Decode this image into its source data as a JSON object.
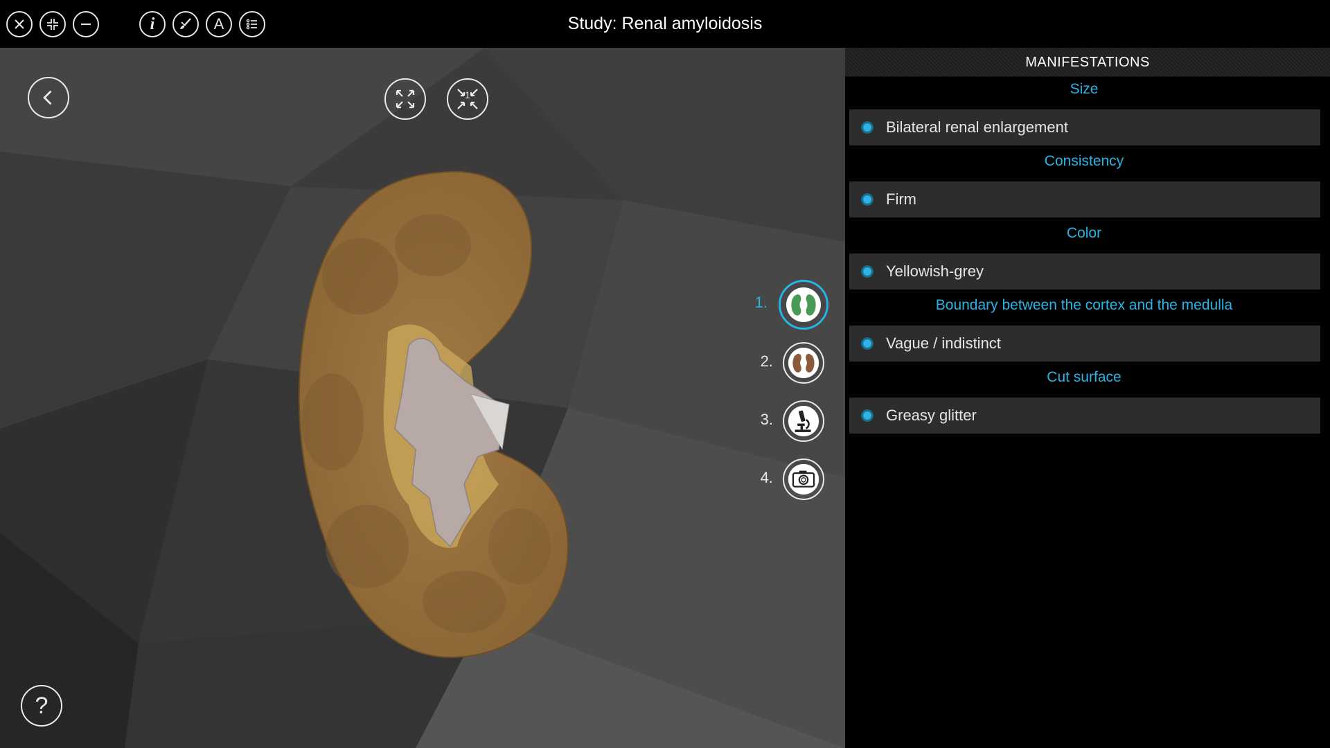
{
  "window": {
    "title": "Study: Renal amyloidosis"
  },
  "toolbar": {
    "left_icons": [
      "close-icon",
      "collapse-icon",
      "minimize-icon"
    ],
    "right_icons": [
      "info-icon",
      "brush-icon",
      "text-icon",
      "list-icon"
    ],
    "text_icon_glyph": "A",
    "info_glyph": "i"
  },
  "viewport": {
    "fit_view_icon": "expand-icon",
    "reset_view_badge": "1",
    "help_glyph": "?",
    "steps": [
      {
        "label": "1.",
        "icon": "kidney-green-icon",
        "active": true
      },
      {
        "label": "2.",
        "icon": "kidney-brown-icon",
        "active": false
      },
      {
        "label": "3.",
        "icon": "microscope-icon",
        "active": false
      },
      {
        "label": "4.",
        "icon": "camera-icon",
        "active": false
      }
    ]
  },
  "panel": {
    "header": "MANIFESTATIONS",
    "sections": [
      {
        "category": "Size",
        "value": "Bilateral renal enlargement"
      },
      {
        "category": "Consistency",
        "value": "Firm"
      },
      {
        "category": "Color",
        "value": "Yellowish-grey"
      },
      {
        "category": "Boundary between the cortex and the medulla",
        "value": "Vague / indistinct"
      },
      {
        "category": "Cut surface",
        "value": "Greasy glitter"
      }
    ]
  },
  "colors": {
    "accent": "#2ab4e6",
    "panel_item_bg": "#2d2d2d",
    "viewport_bg": "#3b3b3b"
  }
}
